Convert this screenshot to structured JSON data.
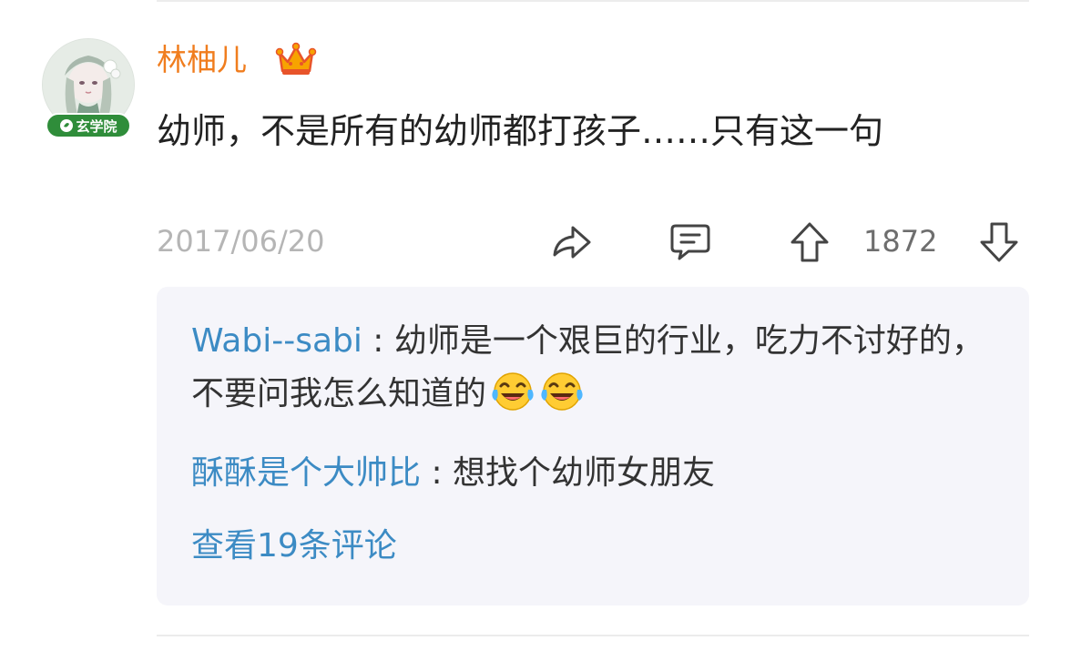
{
  "post": {
    "username": "林柚儿",
    "badge_label": "玄学院",
    "text": "幼师，不是所有的幼师都打孩子……只有这一句",
    "date": "2017/06/20",
    "vote_count": "1872"
  },
  "replies": [
    {
      "author": "Wabi--sabi",
      "separator": " : ",
      "text": "幼师是一个艰巨的行业，吃力不讨好的，不要问我怎么知道的",
      "emojis": [
        "laughing-tears-emoji",
        "laughing-tears-emoji"
      ]
    },
    {
      "author": "酥酥是个大帅比",
      "separator": " : ",
      "text": "想找个幼师女朋友"
    }
  ],
  "more_replies_label": "查看19条评论",
  "colors": {
    "username": "#f07d1e",
    "reply_author": "#3c8bc4",
    "date": "#b5b5b5",
    "reply_box_bg": "#f5f5fa",
    "badge": "#2f8d3a"
  }
}
